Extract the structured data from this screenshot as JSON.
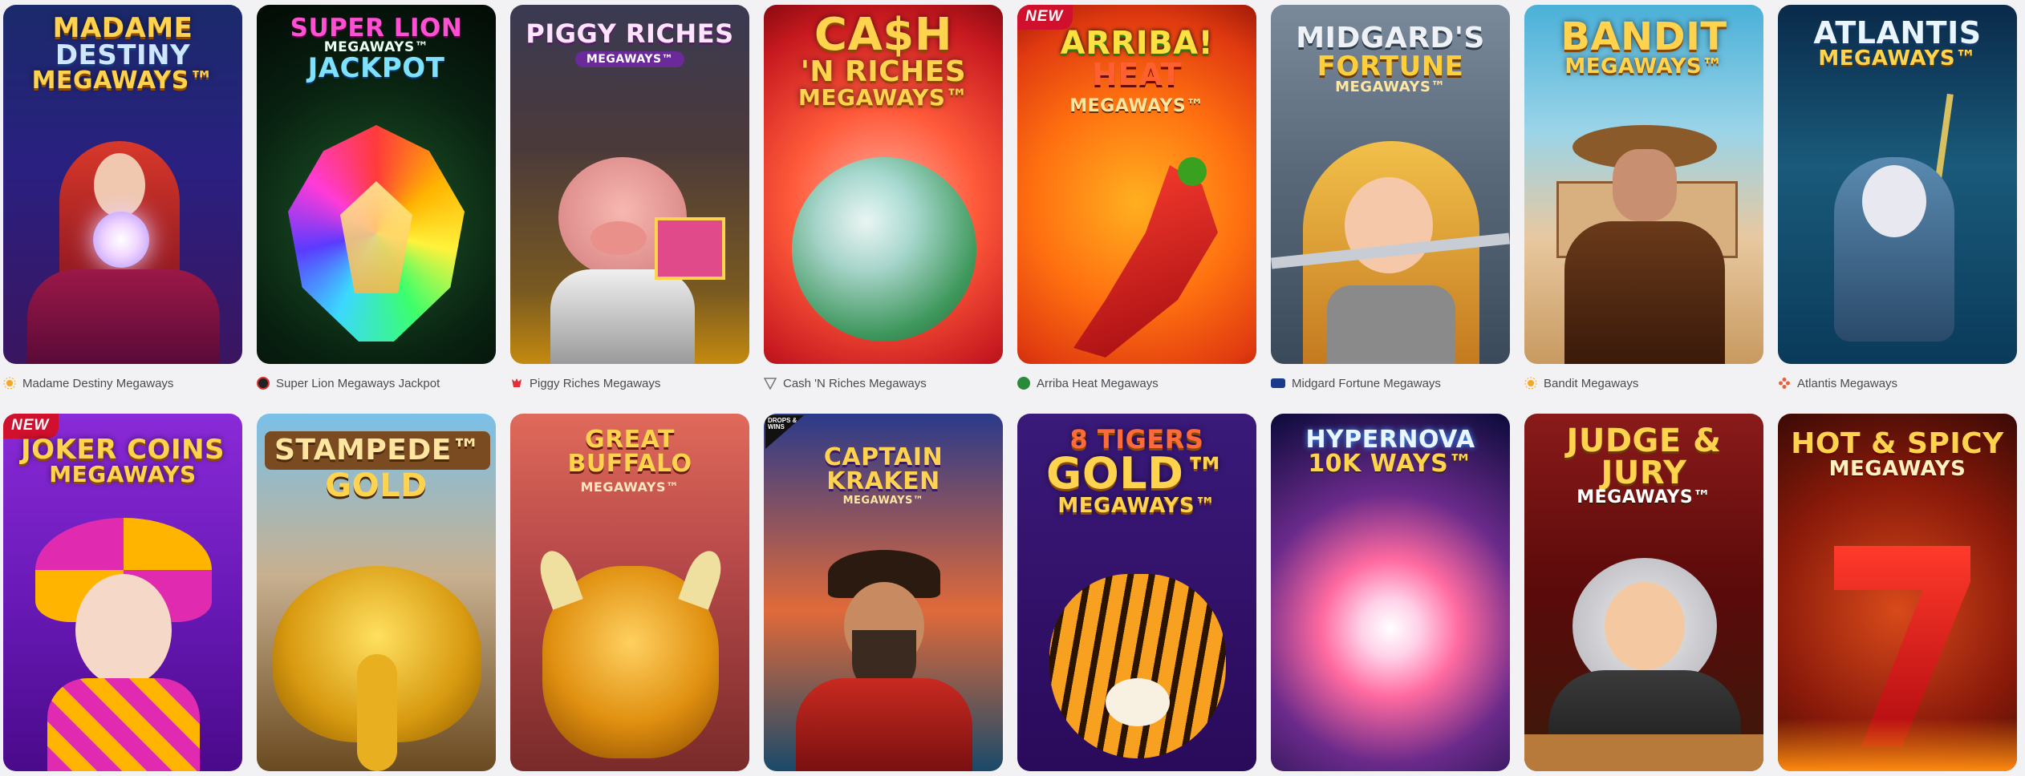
{
  "badges": {
    "new": "NEW",
    "drops_wins": "DROPS & WINS"
  },
  "rows": [
    [
      {
        "name": "Madame Destiny Megaways",
        "title_lines": [
          "MADAME",
          "DESTINY",
          "MEGAWAYS™"
        ],
        "provider_icon": "pragmatic-sun-icon",
        "new": false
      },
      {
        "name": "Super Lion Megaways Jackpot",
        "title_lines": [
          "SUPER LION",
          "MEGAWAYS™",
          "JACKPOT"
        ],
        "provider_icon": "circle-logo-icon",
        "new": false
      },
      {
        "name": "Piggy Riches Megaways",
        "title_lines": [
          "PIGGY RICHES",
          "MEGAWAYS™"
        ],
        "provider_icon": "red-tiger-icon",
        "new": false
      },
      {
        "name": "Cash 'N Riches Megaways",
        "title_lines": [
          "CA$H",
          "'N RICHES",
          "MEGAWAYS™"
        ],
        "provider_icon": "triangle-logo-icon",
        "new": false
      },
      {
        "name": "Arriba Heat Megaways",
        "title_lines": [
          "ARRIBA!",
          "HEAT",
          "MEGAWAYS™"
        ],
        "provider_icon": "green-circle-icon",
        "new": true
      },
      {
        "name": "Midgard Fortune Megaways",
        "title_lines": [
          "MIDGARD'S",
          "FORTUNE",
          "MEGAWAYS™"
        ],
        "provider_icon": "blueprint-icon",
        "new": false
      },
      {
        "name": "Bandit Megaways",
        "title_lines": [
          "BANDIT",
          "MEGAWAYS™"
        ],
        "provider_icon": "pragmatic-sun-icon",
        "new": false
      },
      {
        "name": "Atlantis Megaways",
        "title_lines": [
          "ATLANTIS",
          "MEGAWAYS™"
        ],
        "provider_icon": "flower-logo-icon",
        "new": false
      }
    ],
    [
      {
        "title_lines": [
          "JOKER COINS",
          "MEGAWAYS"
        ],
        "new": true,
        "drops_wins": false
      },
      {
        "title_lines": [
          "STAMPEDE™",
          "GOLD"
        ],
        "new": false,
        "drops_wins": false
      },
      {
        "title_lines": [
          "GREAT BUFFALO",
          "MEGAWAYS™"
        ],
        "new": false,
        "drops_wins": false
      },
      {
        "title_lines": [
          "CAPTAIN KRAKEN",
          "MEGAWAYS™"
        ],
        "new": false,
        "drops_wins": true
      },
      {
        "title_lines": [
          "8 TIGERS",
          "GOLD™",
          "MEGAWAYS™"
        ],
        "new": false,
        "drops_wins": false
      },
      {
        "title_lines": [
          "HYPERNOVA",
          "10K WAYS™"
        ],
        "new": false,
        "drops_wins": false
      },
      {
        "title_lines": [
          "JUDGE &",
          "JURY",
          "MEGAWAYS™"
        ],
        "new": false,
        "drops_wins": false
      },
      {
        "title_lines": [
          "HOT & SPICY",
          "MEGAWAYS"
        ],
        "new": false,
        "drops_wins": false
      }
    ]
  ],
  "colors": {
    "new_badge": "#d0102c",
    "label_text": "#4a4a52",
    "page_bg": "#f2f2f4"
  }
}
